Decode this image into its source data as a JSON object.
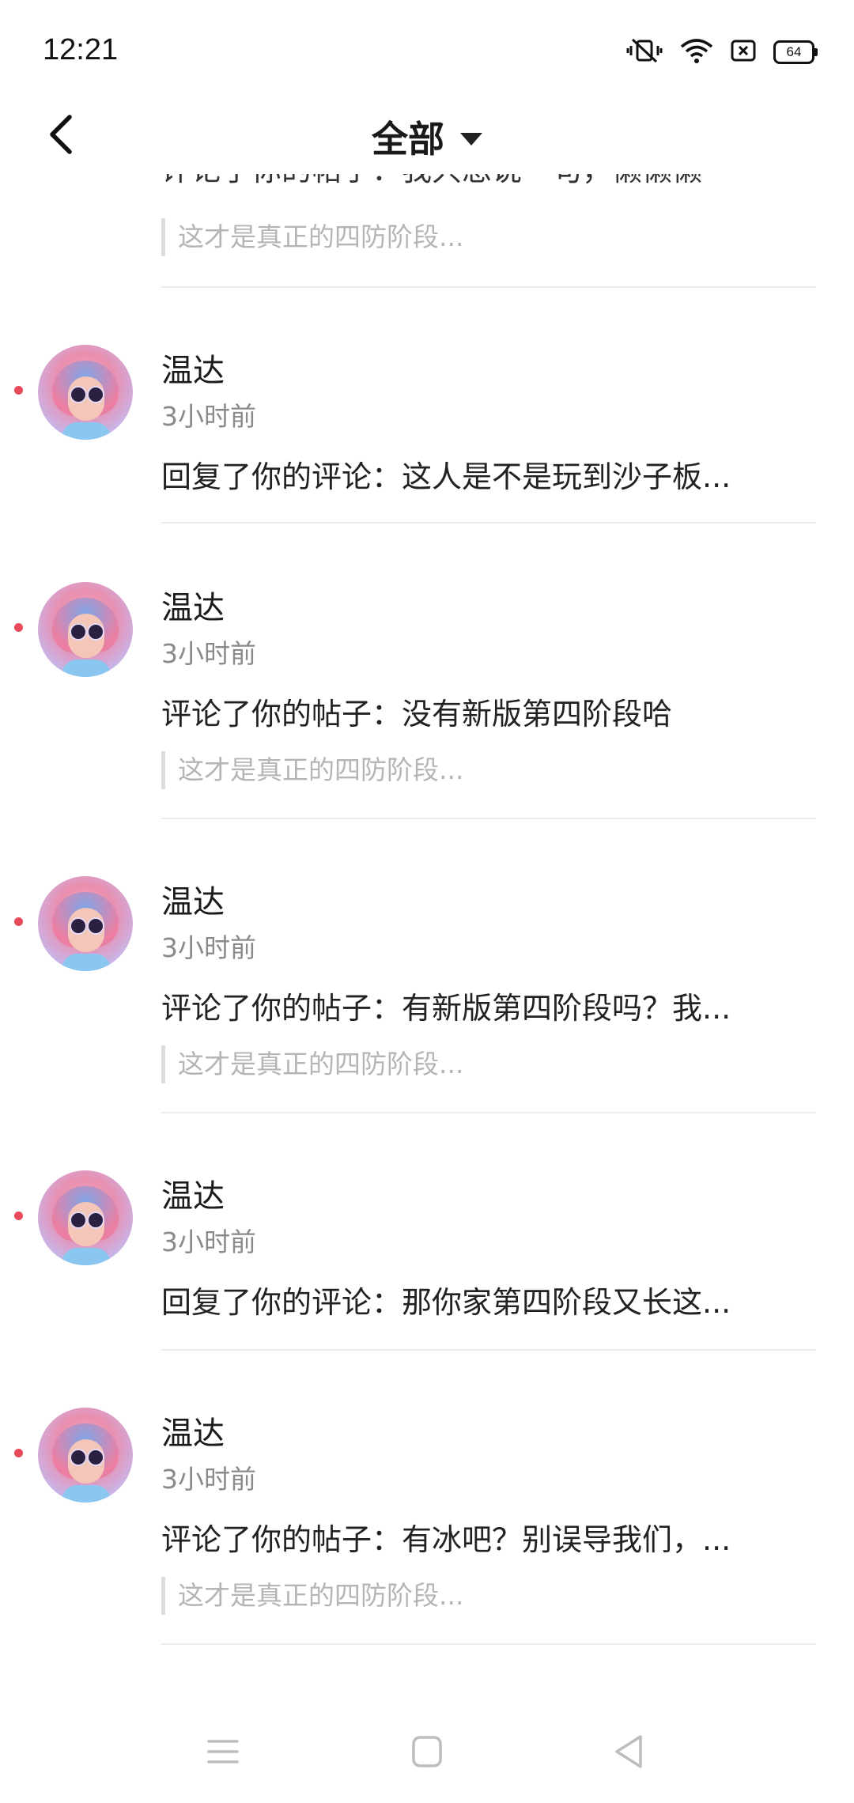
{
  "status_bar": {
    "time": "12:21",
    "battery": "64"
  },
  "header": {
    "title": "全部"
  },
  "partial_item": {
    "content": "评论了你的帖子：我只想说一句，懒懒懒",
    "quote": "这才是真正的四防阶段..."
  },
  "notifications": [
    {
      "name": "温达",
      "time": "3小时前",
      "content": "回复了你的评论：这人是不是玩到沙子板...",
      "quote": ""
    },
    {
      "name": "温达",
      "time": "3小时前",
      "content": "评论了你的帖子：没有新版第四阶段哈",
      "quote": "这才是真正的四防阶段..."
    },
    {
      "name": "温达",
      "time": "3小时前",
      "content": "评论了你的帖子：有新版第四阶段吗？我...",
      "quote": "这才是真正的四防阶段..."
    },
    {
      "name": "温达",
      "time": "3小时前",
      "content": "回复了你的评论：那你家第四阶段又长这...",
      "quote": ""
    },
    {
      "name": "温达",
      "time": "3小时前",
      "content": "评论了你的帖子：有冰吧？别误导我们，...",
      "quote": "这才是真正的四防阶段..."
    }
  ],
  "icons": {
    "back": "back-arrow-icon",
    "dropdown": "caret-down-icon",
    "silent": "vibrate-silent-icon",
    "wifi": "wifi-icon",
    "sim": "sim-card-icon",
    "battery": "battery-icon",
    "menu": "menu-icon",
    "home": "home-icon",
    "back_nav": "back-triangle-icon"
  },
  "colors": {
    "unread_dot": "#e84a5a",
    "divider": "#ececec",
    "quote_bar": "#dcdcdc"
  }
}
